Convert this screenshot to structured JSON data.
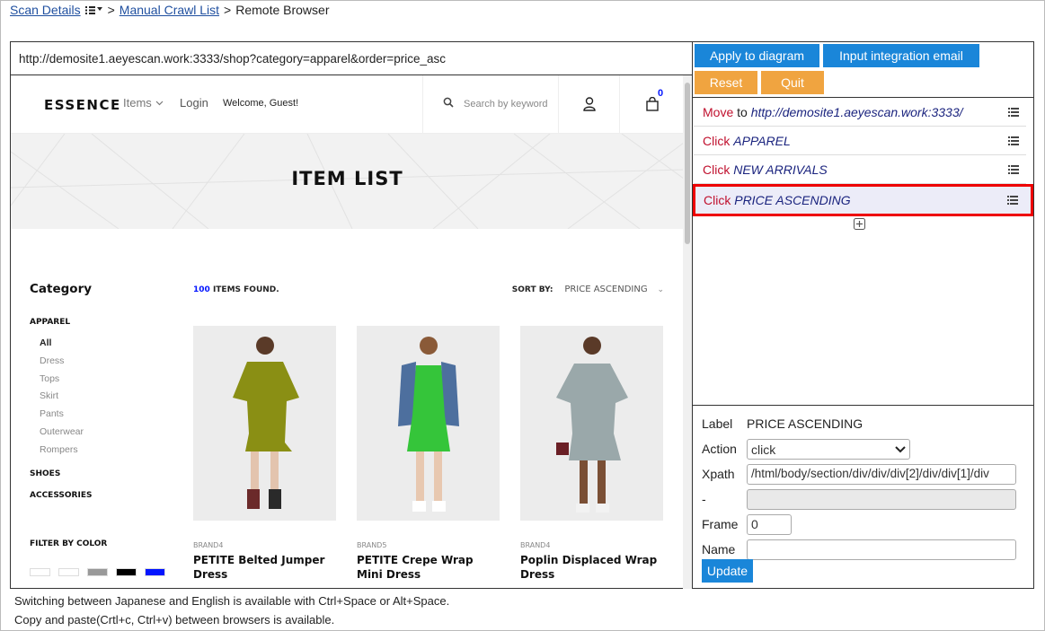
{
  "breadcrumb": {
    "scan_details": "Scan Details",
    "manual_crawl_list": "Manual Crawl List",
    "current": "Remote Browser",
    "sep": ">"
  },
  "url": "http://demosite1.aeyescan.work:3333/shop?category=apparel&order=price_asc",
  "shop": {
    "logo": "ESSENCE",
    "nav_items": "Items",
    "nav_login": "Login",
    "welcome": "Welcome, Guest!",
    "search_placeholder": "Search by keyword",
    "cart_count": "0",
    "hero_title": "ITEM LIST",
    "sidebar": {
      "title": "Category",
      "apparel": "APPAREL",
      "sub": [
        "All",
        "Dress",
        "Tops",
        "Skirt",
        "Pants",
        "Outerwear",
        "Rompers"
      ],
      "shoes": "SHOES",
      "accessories": "ACCESSORIES",
      "filter_title": "FILTER BY COLOR",
      "colors": [
        "#ffffff",
        "#ffffff",
        "#999999",
        "#000000",
        "#0315ff"
      ]
    },
    "found_count": "100",
    "found_label": "ITEMS FOUND.",
    "sort_label": "SORT BY:",
    "sort_value": "PRICE ASCENDING",
    "products": [
      {
        "brand": "BRAND4",
        "name": "PETITE Belted Jumper Dress",
        "dress_color": "#8a8f14"
      },
      {
        "brand": "BRAND5",
        "name": "PETITE Crepe Wrap Mini Dress",
        "dress_color": "#35c53a"
      },
      {
        "brand": "BRAND4",
        "name": "Poplin Displaced Wrap Dress",
        "dress_color": "#9aa8aa"
      }
    ]
  },
  "panel": {
    "apply_button": "Apply to diagram",
    "email_button": "Input integration email",
    "reset_button": "Reset",
    "quit_button": "Quit",
    "steps": [
      {
        "action": "Move",
        "connector": "to",
        "target": "http://demosite1.aeyescan.work:3333/"
      },
      {
        "action": "Click",
        "connector": "",
        "target": "APPAREL"
      },
      {
        "action": "Click",
        "connector": "",
        "target": "NEW ARRIVALS"
      },
      {
        "action": "Click",
        "connector": "",
        "target": "PRICE ASCENDING"
      }
    ],
    "form": {
      "label_label": "Label",
      "label_value": "PRICE ASCENDING",
      "action_label": "Action",
      "action_value": "click",
      "xpath_label": "Xpath",
      "xpath_value": "/html/body/section/div/div/div[2]/div/div[1]/div",
      "dash_label": "-",
      "frame_label": "Frame",
      "frame_value": "0",
      "name_label": "Name",
      "name_value": "",
      "update_button": "Update"
    }
  },
  "footer": {
    "line1": "Switching between Japanese and English is available with Ctrl+Space or Alt+Space.",
    "line2": "Copy and paste(Crtl+c, Ctrl+v) between browsers is available."
  }
}
